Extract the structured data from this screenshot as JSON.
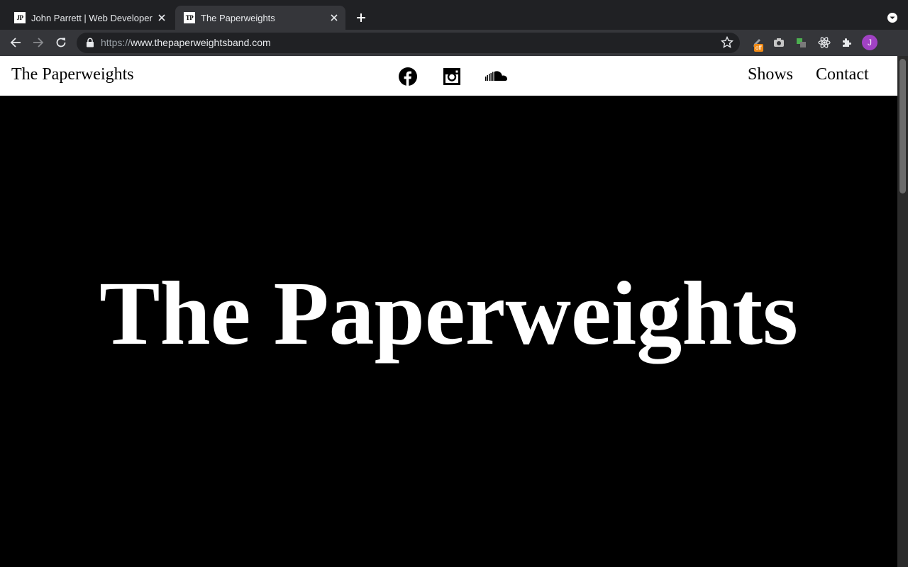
{
  "browser": {
    "tabs": [
      {
        "favicon_text": "JP",
        "title": "John Parrett | Web Developer"
      },
      {
        "favicon_text": "TP",
        "title": "The Paperweights"
      }
    ],
    "url_scheme": "https://",
    "url_host": "www.thepaperweightsband.com",
    "extension_badge": "off",
    "profile_initial": "J",
    "colors": {
      "tabbar": "#202124",
      "toolbar": "#35363a",
      "avatar": "#a142c4",
      "badge": "#f28b16"
    }
  },
  "site": {
    "logo": "The Paperweights",
    "social_icons": [
      "facebook-icon",
      "instagram-icon",
      "soundcloud-icon"
    ],
    "nav": {
      "shows": "Shows",
      "contact": "Contact"
    },
    "hero_title": "The Paperweights",
    "colors": {
      "header_bg": "#ffffff",
      "hero_bg": "#000000",
      "hero_text": "#ffffff"
    }
  }
}
